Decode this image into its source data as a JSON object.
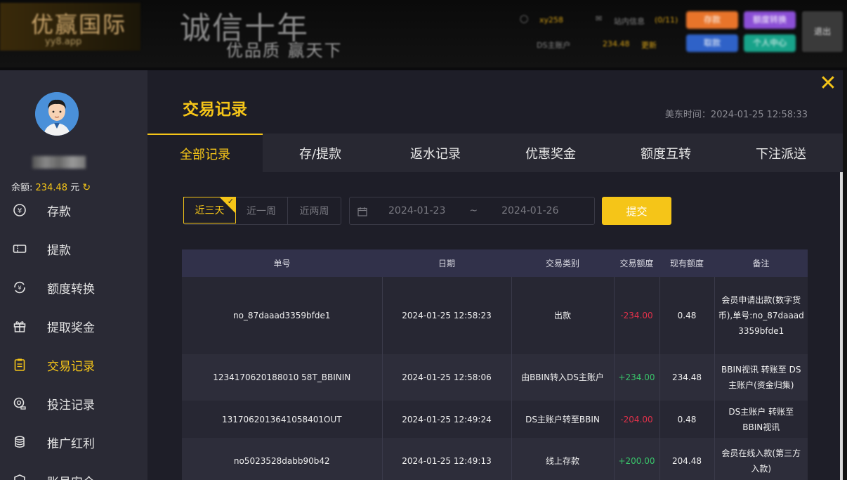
{
  "header": {
    "logo_text": "优赢国际",
    "logo_sub": "yy8.app",
    "slogan_main": "诚信十年",
    "slogan_sub": "优品质  赢天下",
    "user_label": "xy258",
    "msg_label": "站内信息",
    "msg_count": "(0/11)",
    "account_label": "DS主账户",
    "account_amount": "234.48",
    "refresh_label": "更新",
    "btn_deposit": "存款",
    "btn_transfer": "额度转换",
    "btn_withdraw": "取款",
    "btn_profile": "个人中心",
    "btn_logout": "退出",
    "colors": {
      "deposit": "#e8742a",
      "transfer": "#8b4fd6",
      "withdraw": "#2f62c8",
      "profile": "#18a38a"
    }
  },
  "sidebar": {
    "balance_label": "余额:",
    "balance_value": "234.48",
    "balance_unit": "元",
    "items": [
      {
        "label": "存款",
        "icon": "yen-circle-icon"
      },
      {
        "label": "提款",
        "icon": "ticket-icon"
      },
      {
        "label": "额度转换",
        "icon": "exchange-yen-icon"
      },
      {
        "label": "提取奖金",
        "icon": "gift-icon"
      },
      {
        "label": "交易记录",
        "icon": "clipboard-icon",
        "active": true
      },
      {
        "label": "投注记录",
        "icon": "bet-icon"
      },
      {
        "label": "推广红利",
        "icon": "coins-icon"
      },
      {
        "label": "账号安全",
        "icon": "shield-icon"
      }
    ]
  },
  "main": {
    "title": "交易记录",
    "us_time": "美东时间：2024-01-25 12:58:33",
    "tabs": [
      "全部记录",
      "存/提款",
      "返水记录",
      "优惠奖金",
      "额度互转",
      "下注派送"
    ],
    "active_tab": 0,
    "ranges": [
      "近三天",
      "近一周",
      "近两周"
    ],
    "date_from": "2024-01-23",
    "date_sep": "~",
    "date_to": "2024-01-26",
    "submit": "提交"
  },
  "table": {
    "headers": [
      "单号",
      "日期",
      "交易类别",
      "交易额度",
      "现有额度",
      "备注"
    ],
    "rows": [
      {
        "id": "no_87daaad3359bfde1",
        "date": "2024-01-25 12:58:23",
        "type": "出款",
        "amount": "-234.00",
        "balance": "0.48",
        "note": "会员申请出款(数字货币),单号:no_87daaad3359bfde1"
      },
      {
        "id": "1234170620188010 58T_BBININ",
        "date": "2024-01-25 12:58:06",
        "type": "由BBIN转入DS主账户",
        "amount": "+234.00",
        "balance": "234.48",
        "note": "BBIN视讯 转账至 DS主账户(资金归集)"
      },
      {
        "id": "1317062013641058401OUT",
        "date": "2024-01-25 12:49:24",
        "type": "DS主账户转至BBIN",
        "amount": "-204.00",
        "balance": "0.48",
        "note": "DS主账户 转账至 BBIN视讯"
      },
      {
        "id": "no5023528dabb90b42",
        "date": "2024-01-25 12:49:13",
        "type": "线上存款",
        "amount": "+200.00",
        "balance": "204.48",
        "note": "会员在线入款(第三方入款)"
      }
    ]
  },
  "accent_color": "#f5c518"
}
